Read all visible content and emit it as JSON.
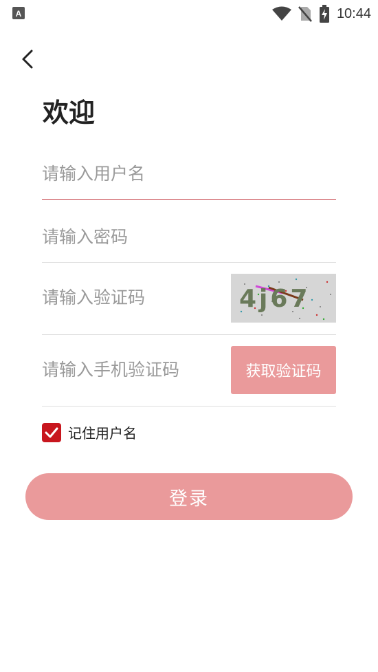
{
  "status_bar": {
    "time": "10:44",
    "icons": [
      "app-notification-icon",
      "wifi-icon",
      "no-sim-icon",
      "battery-charging-icon"
    ]
  },
  "header": {
    "back_icon": "chevron-left-icon",
    "title": "欢迎"
  },
  "form": {
    "username_placeholder": "请输入用户名",
    "password_placeholder": "请输入密码",
    "captcha_placeholder": "请输入验证码",
    "captcha_text": "4j67",
    "sms_placeholder": "请输入手机验证码",
    "sms_button_label": "获取验证码",
    "remember_label": "记住用户名",
    "remember_checked": true,
    "login_button_label": "登录"
  },
  "colors": {
    "accent_red": "#c8161e",
    "button_pink": "#ea9a9b",
    "active_underline": "#c0323a",
    "divider": "#dedede",
    "placeholder_gray": "#9a9a9a"
  }
}
